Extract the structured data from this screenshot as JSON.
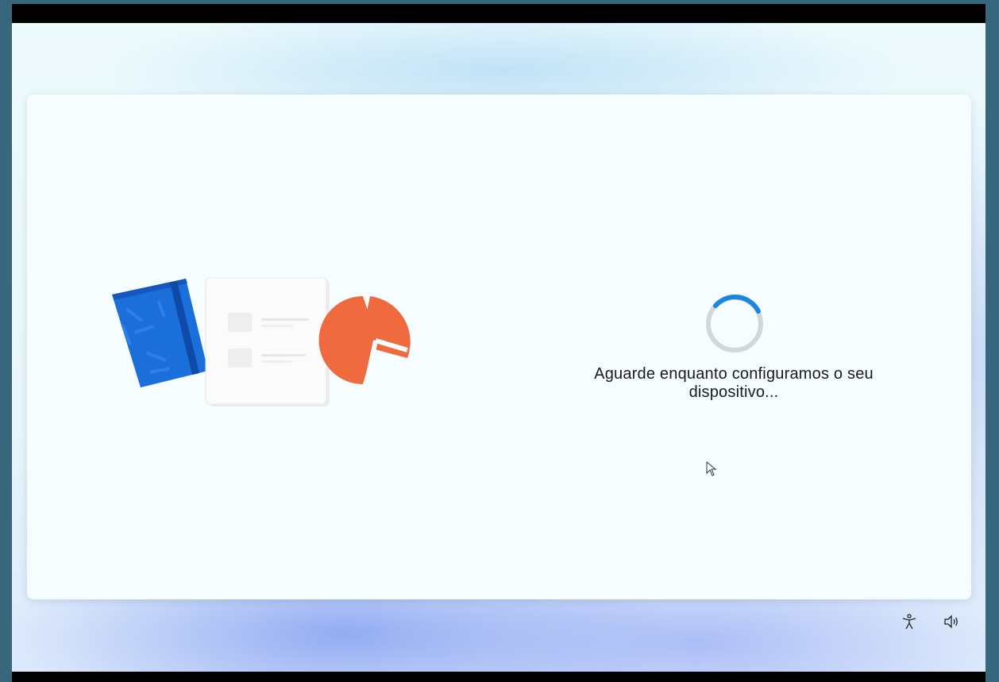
{
  "setup": {
    "status_message": "Aguarde enquanto configuramos o seu dispositivo..."
  },
  "icons": {
    "illustration": [
      "notebook-icon",
      "checklist-icon",
      "pie-chart-icon"
    ],
    "spinner": "loading-spinner",
    "accessibility": "accessibility-icon",
    "volume": "volume-icon"
  },
  "colors": {
    "notebook_blue": "#1a6fdb",
    "pie_orange": "#ef6a3f",
    "spinner_accent": "#1a86e0",
    "spinner_track": "#d4d7da",
    "text": "#1b1b1b"
  }
}
